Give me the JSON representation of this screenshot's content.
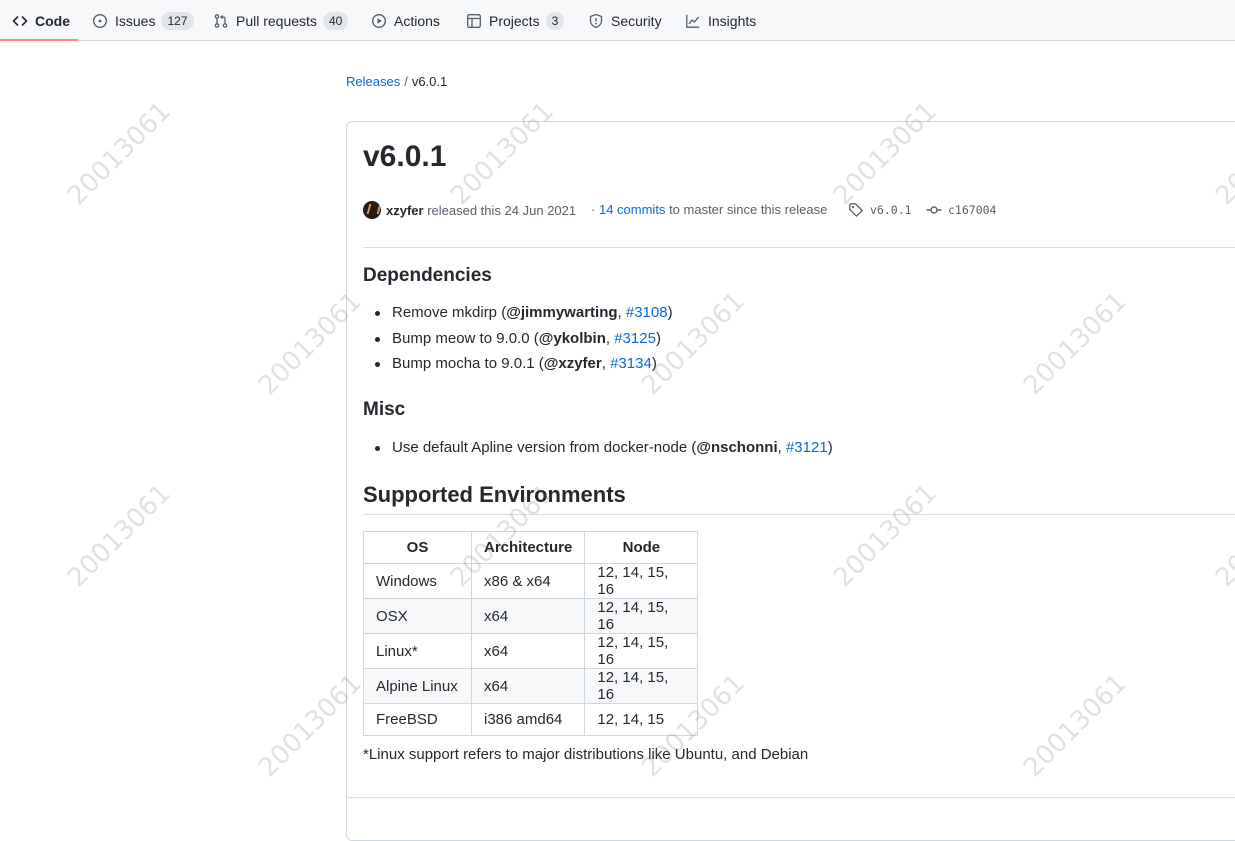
{
  "tabs": [
    {
      "label": "Code",
      "icon": "code-icon",
      "counter": ""
    },
    {
      "label": "Issues",
      "icon": "issue-opened-icon",
      "counter": "127"
    },
    {
      "label": "Pull requests",
      "icon": "git-pull-request-icon",
      "counter": "40"
    },
    {
      "label": "Actions",
      "icon": "play-icon",
      "counter": ""
    },
    {
      "label": "Projects",
      "icon": "table-icon",
      "counter": "3"
    },
    {
      "label": "Security",
      "icon": "shield-icon",
      "counter": ""
    },
    {
      "label": "Insights",
      "icon": "graph-icon",
      "counter": ""
    }
  ],
  "breadcrumb": {
    "root": "Releases",
    "separator": "/",
    "current": "v6.0.1"
  },
  "release": {
    "title": "v6.0.1",
    "author": "xzyfer",
    "released_text": "released this",
    "date": "24 Jun 2021",
    "commits_prefix": "·",
    "commits_link": "14 commits",
    "commits_suffix": "to master since this release",
    "tag": "v6.0.1",
    "commit": "c167004"
  },
  "sections": {
    "dependencies": {
      "heading": "Dependencies",
      "items": [
        {
          "text": "Remove mkdirp (",
          "user": "@jimmywarting",
          "sep": ", ",
          "pr": "#3108",
          "end": ")"
        },
        {
          "text": "Bump meow to 9.0.0 (",
          "user": "@ykolbin",
          "sep": ", ",
          "pr": "#3125",
          "end": ")"
        },
        {
          "text": "Bump mocha to 9.0.1 (",
          "user": "@xzyfer",
          "sep": ", ",
          "pr": "#3134",
          "end": ")"
        }
      ]
    },
    "misc": {
      "heading": "Misc",
      "items": [
        {
          "text": "Use default Apline version from docker-node (",
          "user": "@nschonni",
          "sep": ", ",
          "pr": "#3121",
          "end": ")"
        }
      ]
    },
    "environments": {
      "heading": "Supported Environments",
      "columns": [
        "OS",
        "Architecture",
        "Node"
      ],
      "rows": [
        [
          "Windows",
          "x86 & x64",
          "12, 14, 15, 16"
        ],
        [
          "OSX",
          "x64",
          "12, 14, 15, 16"
        ],
        [
          "Linux*",
          "x64",
          "12, 14, 15, 16"
        ],
        [
          "Alpine Linux",
          "x64",
          "12, 14, 15, 16"
        ],
        [
          "FreeBSD",
          "i386 amd64",
          "12, 14, 15"
        ]
      ],
      "footnote": "*Linux support refers to major distributions like Ubuntu, and Debian"
    }
  },
  "watermark": "20013061",
  "colors": {
    "link": "#0969da",
    "active_tab_underline": "#fd8c73",
    "text": "#24292f",
    "muted": "#57606a"
  }
}
